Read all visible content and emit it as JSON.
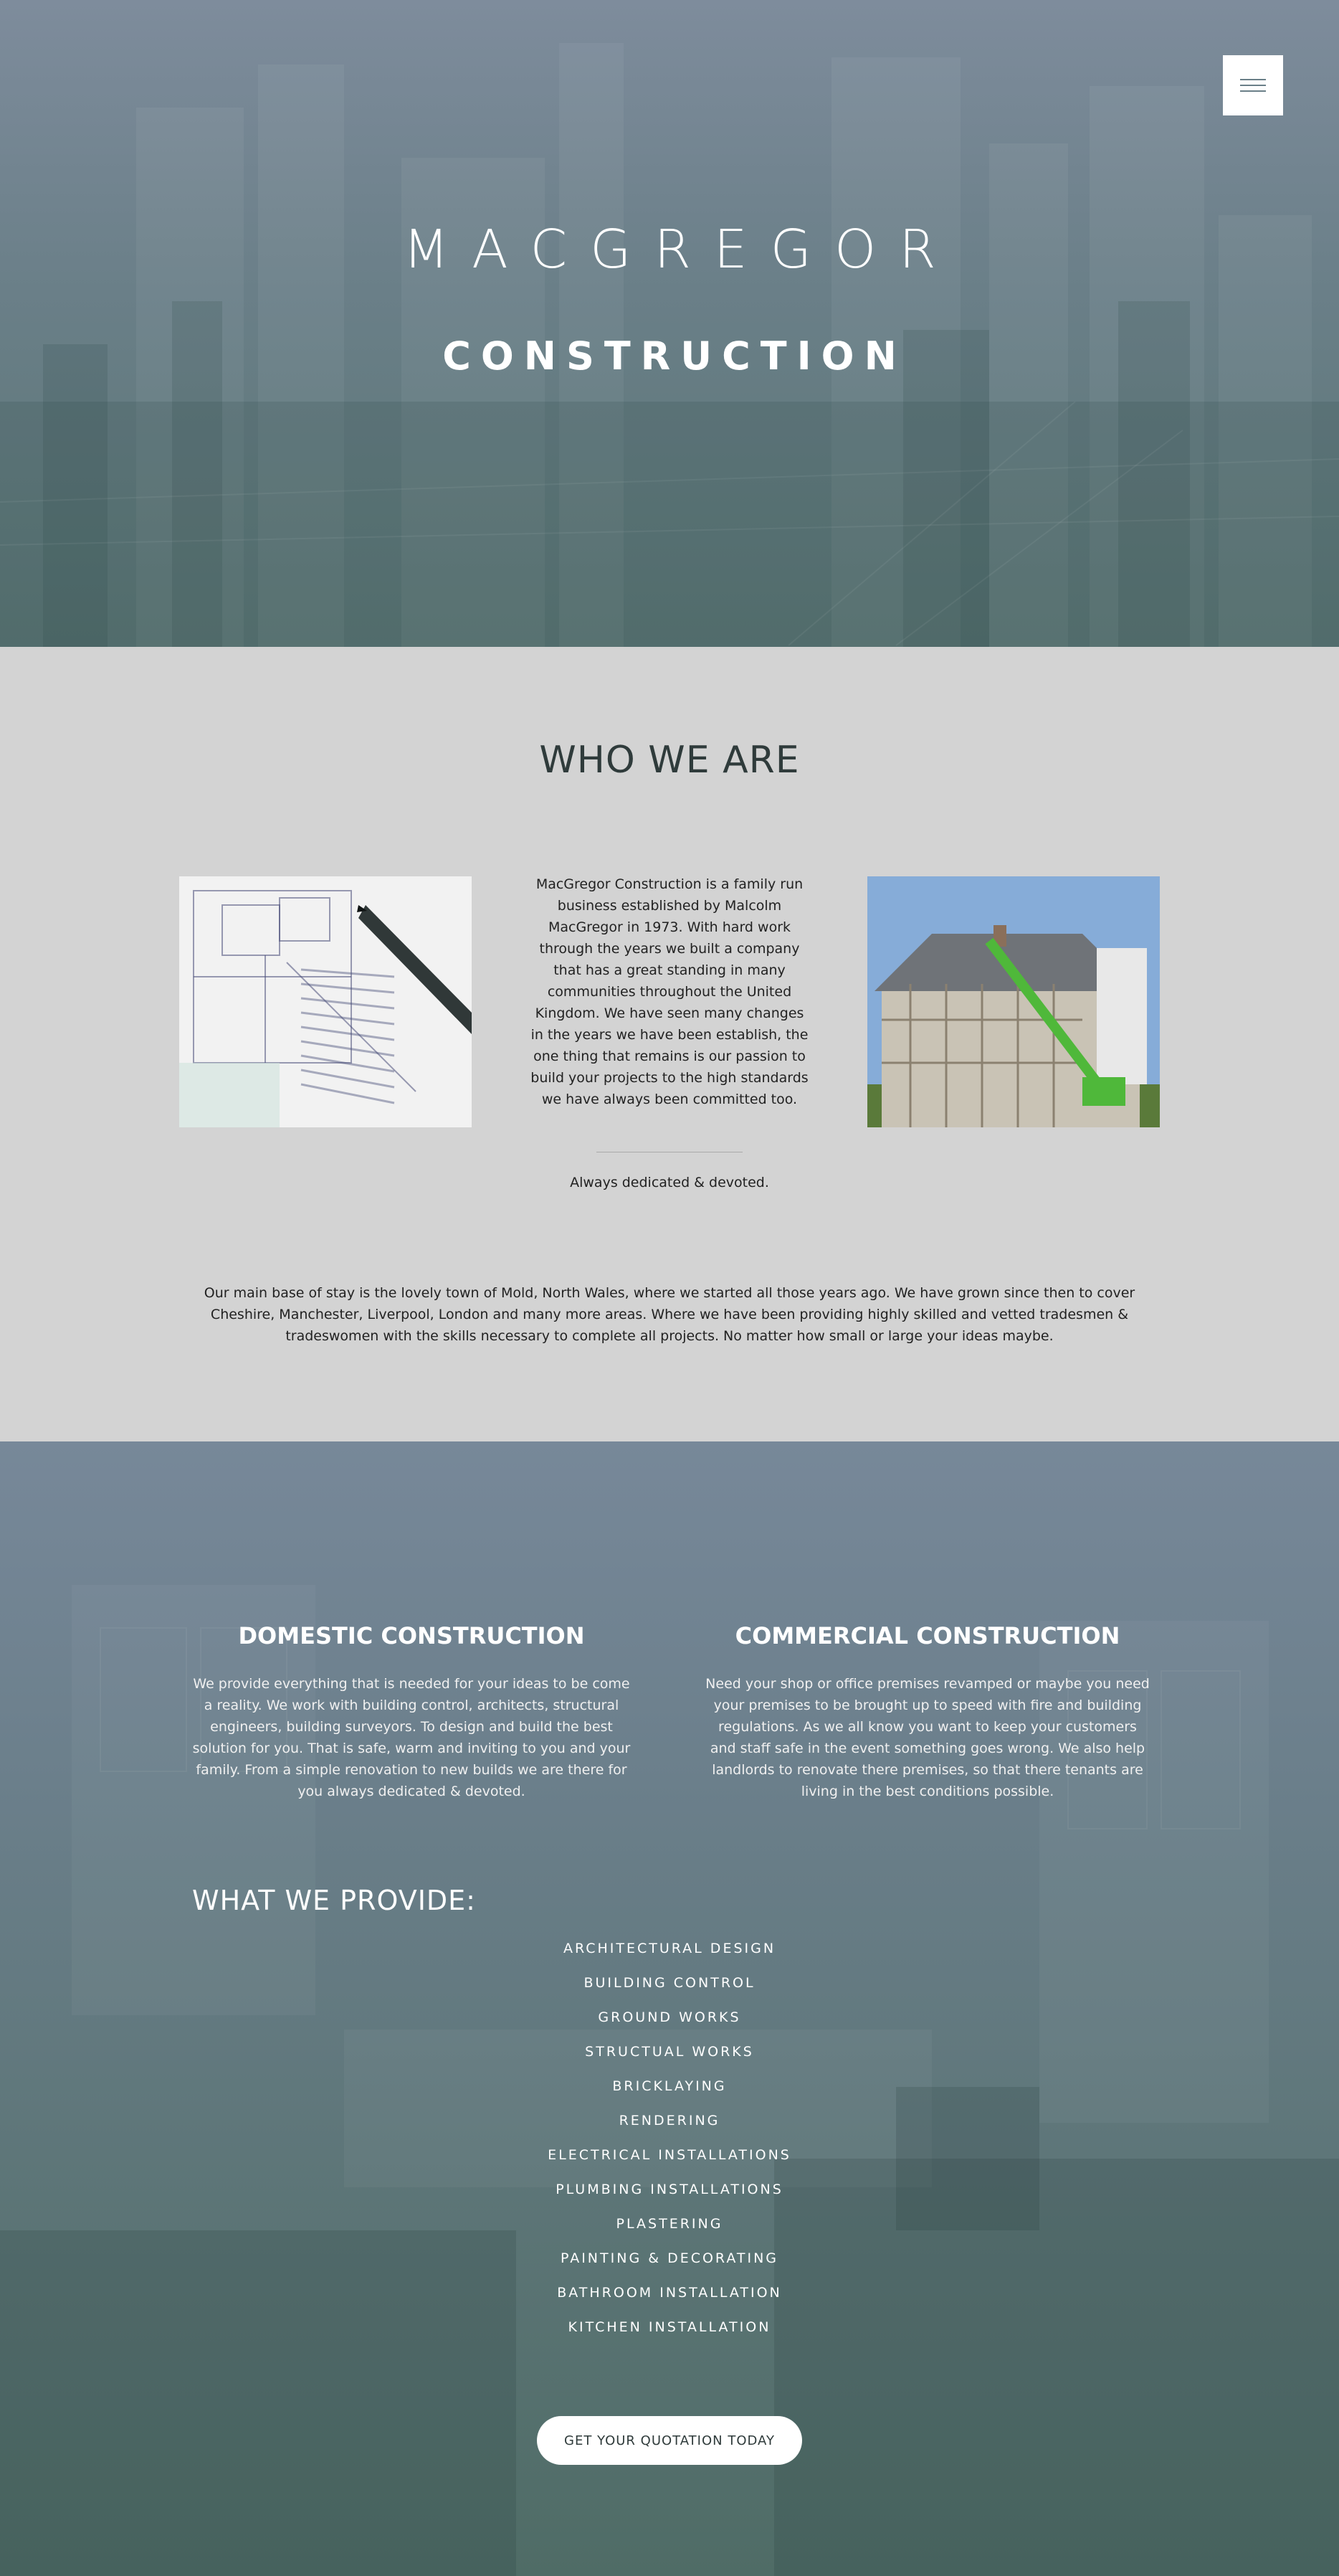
{
  "menu": {
    "icon": "hamburger-menu-icon"
  },
  "hero": {
    "title": "MACGREGOR",
    "subtitle": "CONSTRUCTION"
  },
  "who": {
    "heading": "WHO WE ARE",
    "left_image": "architectural-blueprint-with-pen",
    "right_image": "house-under-scaffolding-with-green-cherry-picker",
    "text": "MacGregor Construction is a family run business established by Malcolm MacGregor in 1973. With hard work through the years we built a company that has a great standing in many communities throughout the United Kingdom. We have seen many changes in the years we have been establish, the one thing that remains is our passion to build your projects to the high standards we have always been committed too.",
    "tagline": "Always dedicated & devoted.",
    "paragraph": "Our main base of stay is the lovely town of Mold, North Wales, where we started all those years ago. We have grown since then to cover Cheshire, Manchester, Liverpool, London and many more areas. Where we have been providing highly skilled and vetted tradesmen & tradeswomen with the skills necessary to complete all projects. No matter how small or large your ideas maybe."
  },
  "domestic": {
    "title": "DOMESTIC CONSTRUCTION",
    "text": "We provide everything that is needed for your ideas to be come a reality. We work with building control, architects, structural engineers, building surveyors. To design and build the best solution for you. That is safe, warm and inviting to you and your family. From a simple renovation to new builds we are there for you always dedicated & devoted."
  },
  "commercial": {
    "title": "COMMERCIAL CONSTRUCTION",
    "text": "Need your shop or office premises revamped or maybe you need your premises to be brought up to speed with fire and building regulations. As we all know you want to keep your customers and staff safe in the event something goes wrong. We also help landlords to renovate there premises, so that there tenants are living in the best conditions possible."
  },
  "provide": {
    "heading": "WHAT WE PROVIDE:",
    "items": [
      "ARCHITECTURAL DESIGN",
      "BUILDING CONTROL",
      "GROUND WORKS",
      "STRUCTUAL WORKS",
      "BRICKLAYING",
      "RENDERING",
      "ELECTRICAL INSTALLATIONS",
      "PLUMBING INSTALLATIONS",
      "PLASTERING",
      "PAINTING & DECORATING",
      "BATHROOM INSTALLATION",
      "KITCHEN INSTALLATION"
    ]
  },
  "cta": {
    "label": "GET YOUR QUOTATION TODAY"
  }
}
